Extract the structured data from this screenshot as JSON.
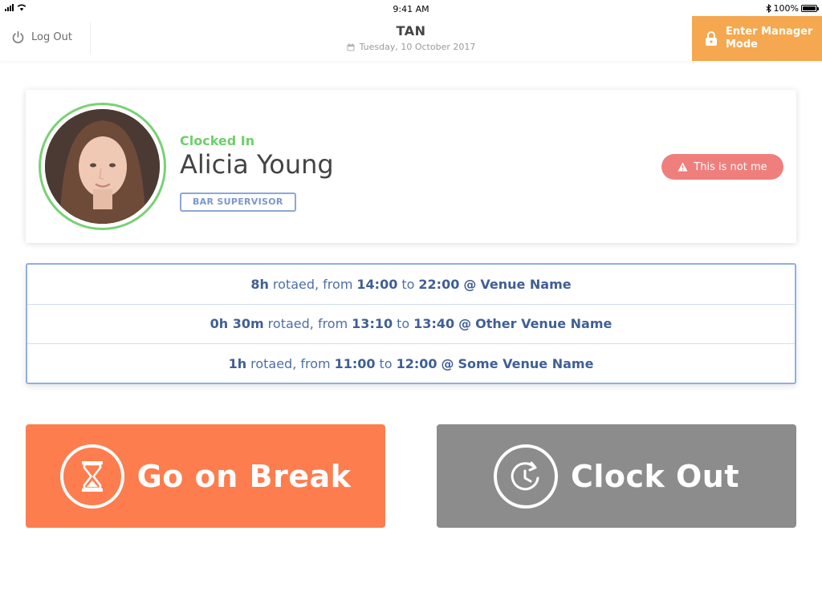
{
  "status_bar": {
    "time": "9:41 AM",
    "battery": "100%"
  },
  "header": {
    "logout_label": "Log Out",
    "venue": "TAN",
    "date": "Tuesday, 10 October 2017",
    "manager_label": "Enter Manager Mode"
  },
  "employee": {
    "status": "Clocked In",
    "name": "Alicia Young",
    "role": "BAR SUPERVISOR",
    "not_me_label": "This is not me"
  },
  "shifts": [
    {
      "duration": "8h",
      "from": "14:00",
      "to": "22:00",
      "venue": "Venue Name"
    },
    {
      "duration": "0h 30m",
      "from": "13:10",
      "to": "13:40",
      "venue": "Other Venue Name"
    },
    {
      "duration": "1h",
      "from": "11:00",
      "to": "12:00",
      "venue": "Some Venue Name"
    }
  ],
  "shift_text": {
    "rotaed_from": "rotaed, from",
    "to": "to",
    "at": "@"
  },
  "actions": {
    "break_label": "Go on Break",
    "clockout_label": "Clock Out"
  },
  "colors": {
    "manager": "#f5a84f",
    "clocked_in": "#6ecf6b",
    "not_me": "#ef7f7d",
    "break": "#fd7d4f",
    "clock_out": "#8c8c8c",
    "shift_text": "#4d6fa6"
  },
  "icons": {
    "logout": "power-icon",
    "date": "calendar-icon",
    "manager": "lock-icon",
    "not_me": "warning-icon",
    "break": "hourglass-icon",
    "clock_out": "clock-return-icon"
  }
}
